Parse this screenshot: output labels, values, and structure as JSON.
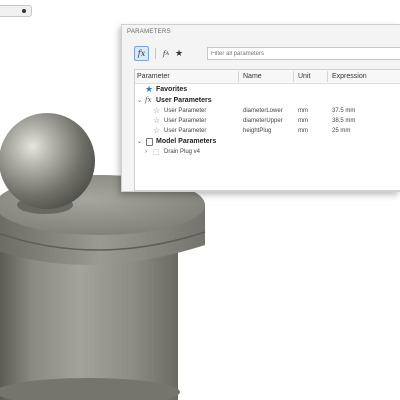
{
  "panel": {
    "title": "PARAMETERS",
    "filter_placeholder": "Filter all parameters",
    "columns": {
      "parameter": "Parameter",
      "name": "Name",
      "unit": "Unit",
      "expression": "Expression"
    },
    "groups": {
      "favorites": "Favorites",
      "user": "User Parameters",
      "model": "Model Parameters"
    },
    "user_params": [
      {
        "parameter": "User Parameter",
        "name": "diameterLower",
        "unit": "mm",
        "expression": "37.5 mm"
      },
      {
        "parameter": "User Parameter",
        "name": "diameterUpper",
        "unit": "mm",
        "expression": "38.5 mm"
      },
      {
        "parameter": "User Parameter",
        "name": "heightPlug",
        "unit": "mm",
        "expression": "25 mm"
      }
    ],
    "model_items": [
      {
        "label": "Drain Plug v4"
      }
    ]
  },
  "icons": {
    "fx_button": "function-fx-icon",
    "fa_button": "font-fx-icon",
    "favorite": "star-icon"
  },
  "colors": {
    "panel_bg": "#f4f4f4",
    "favorite_star": "#2d7ec7",
    "model_gray": "#7a7a72"
  }
}
